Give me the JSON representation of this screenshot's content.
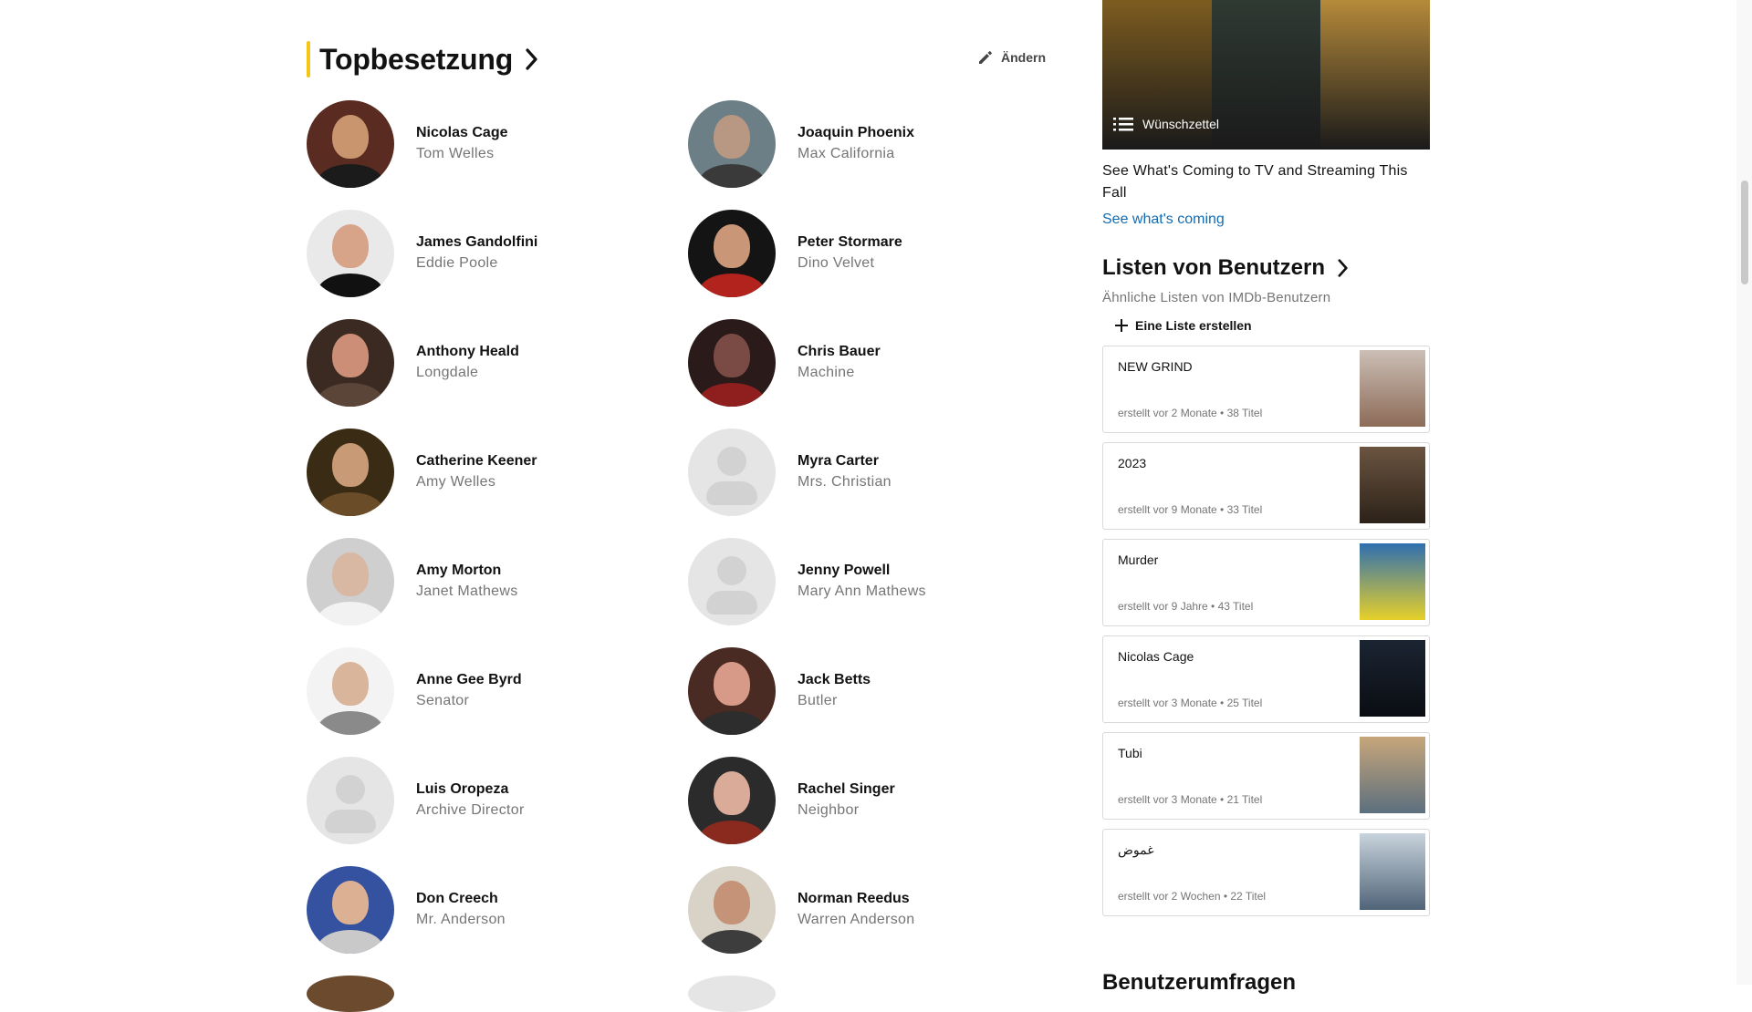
{
  "cast": {
    "title": "Topbesetzung",
    "edit_label": "Ändern",
    "members": [
      {
        "actor": "Nicolas Cage",
        "character": "Tom Welles",
        "has_photo": true,
        "skin": "#c8956e",
        "bg": "#5a2b20",
        "shirt": "#1b1b1b"
      },
      {
        "actor": "Joaquin Phoenix",
        "character": "Max California",
        "has_photo": true,
        "skin": "#b99883",
        "bg": "#6d7f86",
        "shirt": "#3a3a3a"
      },
      {
        "actor": "James Gandolfini",
        "character": "Eddie Poole",
        "has_photo": true,
        "skin": "#d8a489",
        "bg": "#e9e9e9",
        "shirt": "#111111"
      },
      {
        "actor": "Peter Stormare",
        "character": "Dino Velvet",
        "has_photo": true,
        "skin": "#c99777",
        "bg": "#141414",
        "shirt": "#b3231d"
      },
      {
        "actor": "Anthony Heald",
        "character": "Longdale",
        "has_photo": true,
        "skin": "#cc8e76",
        "bg": "#3b2a22",
        "shirt": "#5b4538"
      },
      {
        "actor": "Chris Bauer",
        "character": "Machine",
        "has_photo": true,
        "skin": "#7a4a44",
        "bg": "#2a1a1a",
        "shirt": "#8f1e1e"
      },
      {
        "actor": "Catherine Keener",
        "character": "Amy Welles",
        "has_photo": true,
        "skin": "#c89a76",
        "bg": "#3a2c14",
        "shirt": "#6b4c28"
      },
      {
        "actor": "Myra Carter",
        "character": "Mrs. Christian",
        "has_photo": false
      },
      {
        "actor": "Amy Morton",
        "character": "Janet Mathews",
        "has_photo": true,
        "skin": "#d8b7a3",
        "bg": "#cfcfcf",
        "shirt": "#f2f2f2"
      },
      {
        "actor": "Jenny Powell",
        "character": "Mary Ann Mathews",
        "has_photo": false
      },
      {
        "actor": "Anne Gee Byrd",
        "character": "Senator",
        "has_photo": true,
        "skin": "#d9b59c",
        "bg": "#f3f3f3",
        "shirt": "#8a8a8a"
      },
      {
        "actor": "Jack Betts",
        "character": "Butler",
        "has_photo": true,
        "skin": "#d89a88",
        "bg": "#4a2b23",
        "shirt": "#2d2d2d"
      },
      {
        "actor": "Luis Oropeza",
        "character": "Archive Director",
        "has_photo": false
      },
      {
        "actor": "Rachel Singer",
        "character": "Neighbor",
        "has_photo": true,
        "skin": "#d9ab98",
        "bg": "#2b2b2b",
        "shirt": "#8a2a1f"
      },
      {
        "actor": "Don Creech",
        "character": "Mr. Anderson",
        "has_photo": true,
        "skin": "#dcb093",
        "bg": "#3452a0",
        "shirt": "#c9c9c9"
      },
      {
        "actor": "Norman Reedus",
        "character": "Warren Anderson",
        "has_photo": true,
        "skin": "#c49378",
        "bg": "#d8d3c6",
        "shirt": "#3d3d3d"
      }
    ]
  },
  "promo": {
    "badge_label": "Wünschzettel",
    "caption": "See What's Coming to TV and Streaming This Fall",
    "link": "See what's coming",
    "colors": [
      "#7d5c1f",
      "#2f3a33",
      "#b58a3a"
    ]
  },
  "user_lists": {
    "title": "Listen von Benutzern",
    "subtitle": "Ähnliche Listen von IMDb-Benutzern",
    "create_label": "Eine Liste erstellen",
    "items": [
      {
        "name": "NEW GRIND",
        "meta": "erstellt vor 2 Monate • 38 Titel",
        "thumb_top": "#cbbfb5",
        "thumb_bottom": "#8d6b58"
      },
      {
        "name": "2023",
        "meta": "erstellt vor 9 Monate • 33 Titel",
        "thumb_top": "#6b5440",
        "thumb_bottom": "#2c2219"
      },
      {
        "name": "Murder",
        "meta": "erstellt vor 9 Jahre • 43 Titel",
        "thumb_top": "#2f6fb0",
        "thumb_bottom": "#e6d02a"
      },
      {
        "name": "Nicolas Cage",
        "meta": "erstellt vor 3 Monate • 25 Titel",
        "thumb_top": "#1b2432",
        "thumb_bottom": "#0a0d12"
      },
      {
        "name": "Tubi",
        "meta": "erstellt vor 3 Monate • 21 Titel",
        "thumb_top": "#c7a67a",
        "thumb_bottom": "#5c6f7e"
      },
      {
        "name": "غموض",
        "meta": "erstellt vor 2 Wochen • 22 Titel",
        "thumb_top": "#c8d3dc",
        "thumb_bottom": "#506478"
      }
    ]
  },
  "polls": {
    "title": "Benutzerumfragen"
  },
  "colors": {
    "accent": "#f5c518",
    "link": "#136cb2"
  }
}
